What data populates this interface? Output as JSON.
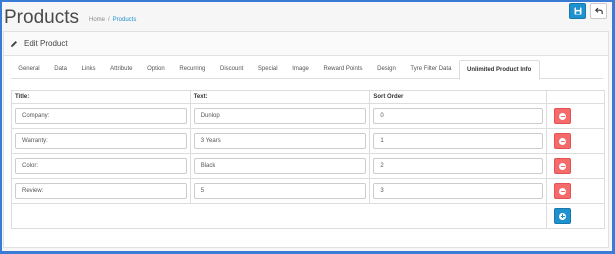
{
  "header": {
    "title": "Products",
    "breadcrumb": [
      "Home",
      "/",
      "Products"
    ]
  },
  "panel": {
    "title": "Edit Product"
  },
  "tabs": [
    {
      "label": "General"
    },
    {
      "label": "Data"
    },
    {
      "label": "Links"
    },
    {
      "label": "Attribute"
    },
    {
      "label": "Option"
    },
    {
      "label": "Recurring"
    },
    {
      "label": "Discount"
    },
    {
      "label": "Special"
    },
    {
      "label": "Image"
    },
    {
      "label": "Reward Points"
    },
    {
      "label": "Design"
    },
    {
      "label": "Tyre Filter Data"
    },
    {
      "label": "Unlimited Product Info",
      "active": true
    }
  ],
  "table": {
    "columns": [
      "Title:",
      "Text:",
      "Sort Order"
    ],
    "rows": [
      {
        "title": "Company:",
        "text": "Dunlop",
        "sort_order": "0"
      },
      {
        "title": "Warranty:",
        "text": "3 Years",
        "sort_order": "1"
      },
      {
        "title": "Color:",
        "text": "Black",
        "sort_order": "2"
      },
      {
        "title": "Review:",
        "text": "5",
        "sort_order": "3"
      }
    ]
  },
  "icons": {
    "save": "save-icon",
    "back": "back-arrow-icon",
    "edit": "pencil-icon",
    "remove": "minus-circle-icon",
    "add": "plus-circle-icon"
  },
  "colors": {
    "primary": "#1e91cf",
    "danger": "#f56b6b",
    "frame": "#3a7bd5"
  }
}
